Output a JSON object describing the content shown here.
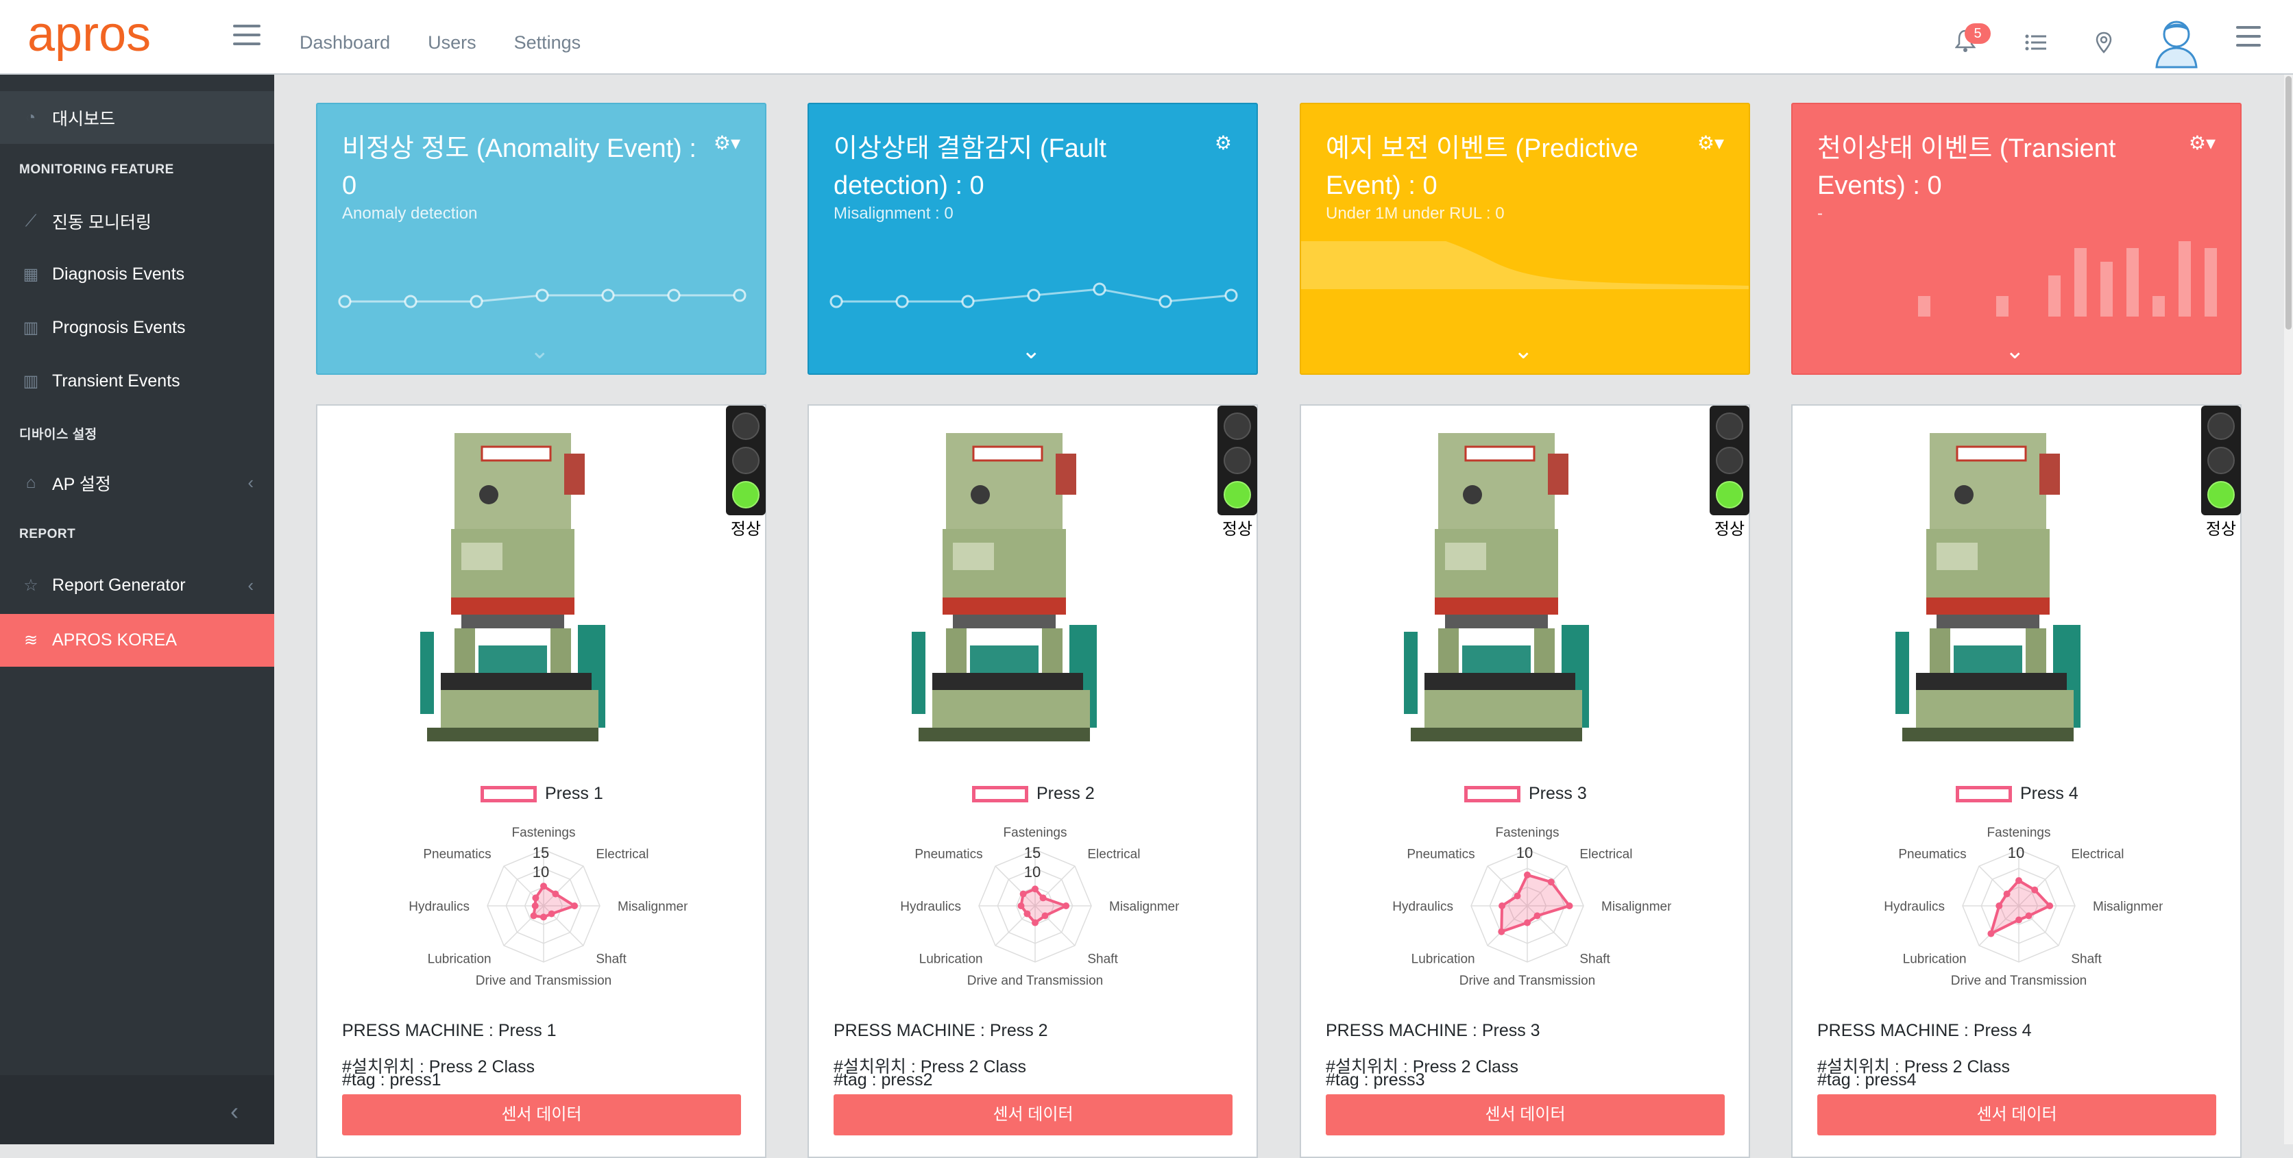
{
  "app": {
    "logo_text": "apros"
  },
  "topnav": [
    "Dashboard",
    "Users",
    "Settings"
  ],
  "notifications": {
    "count": "5"
  },
  "sidebar": {
    "items": [
      {
        "label": "대시보드",
        "icon": "speedometer-icon"
      },
      {
        "title": "MONITORING FEATURE"
      },
      {
        "label": "진동 모니터링",
        "icon": "chart-line-icon"
      },
      {
        "label": "Diagnosis Events",
        "icon": "calendar-icon"
      },
      {
        "label": "Prognosis Events",
        "icon": "bar-chart-icon"
      },
      {
        "label": "Transient Events",
        "icon": "bar-chart-icon"
      },
      {
        "title": "디바이스 설정"
      },
      {
        "label": "AP 설정",
        "icon": "tag-icon"
      },
      {
        "title": "REPORT"
      },
      {
        "label": "Report Generator",
        "icon": "star-icon"
      },
      {
        "label": "APROS KOREA",
        "icon": "layers-icon"
      }
    ]
  },
  "cards": [
    {
      "title": "비정상 정도 (Anomality Event) : 0",
      "sub": "Anomaly detection",
      "color": "#63c2de",
      "line": [
        0,
        0,
        0,
        1,
        1,
        1,
        1
      ]
    },
    {
      "title": "이상상태 결함감지 (Fault detection) : 0",
      "sub": "Misalignment : 0",
      "color": "#20a8d8",
      "line": [
        0,
        0,
        0,
        1,
        2,
        0,
        1
      ]
    },
    {
      "title": "예지 보전 이벤트 (Predictive Event) : 0",
      "sub": "Under 1M under RUL : 0",
      "color": "#ffc107"
    },
    {
      "title": "천이상태 이벤트 (Transient Events) : 0",
      "sub": "-",
      "color": "#f86c6b",
      "bars": [
        0,
        0,
        1.5,
        0,
        0,
        1.5,
        0,
        3,
        5,
        4,
        5,
        1.5,
        7,
        5
      ]
    }
  ],
  "radar_labels": [
    "Fastenings",
    "Electrical",
    "Misalignment",
    "Shaft",
    "Drive and Transmission",
    "Lubrication",
    "Hydraulics",
    "Pneumatics"
  ],
  "machines": [
    {
      "name": "Press 1",
      "status": "정상",
      "machine": "PRESS MACHINE : Press 1",
      "location": "#설치위치 : Press 2 Class",
      "tag": "#tag : press1",
      "button": "센서 데이터",
      "scale": [
        "15",
        "10"
      ],
      "values": [
        0.35,
        0.3,
        0.55,
        0.2,
        0.2,
        0.25,
        0.15,
        0.2
      ]
    },
    {
      "name": "Press 2",
      "status": "정상",
      "machine": "PRESS MACHINE : Press 2",
      "location": "#설치위치 : Press 2 Class",
      "tag": "#tag : press2",
      "button": "센서 데이터",
      "scale": [
        "15",
        "10"
      ],
      "values": [
        0.3,
        0.2,
        0.55,
        0.25,
        0.3,
        0.2,
        0.25,
        0.3
      ]
    },
    {
      "name": "Press 3",
      "status": "정상",
      "machine": "PRESS MACHINE : Press 3",
      "location": "#설치위치 : Press 2 Class",
      "tag": "#tag : press3",
      "button": "센서 데이터",
      "scale": [
        "10"
      ],
      "values": [
        0.55,
        0.6,
        0.75,
        0.25,
        0.3,
        0.65,
        0.45,
        0.25
      ]
    },
    {
      "name": "Press 4",
      "status": "정상",
      "machine": "PRESS MACHINE : Press 4",
      "location": "#설치위치 : Press 2 Class",
      "tag": "#tag : press4",
      "button": "센서 데이터",
      "scale": [
        "10"
      ],
      "values": [
        0.45,
        0.4,
        0.55,
        0.25,
        0.25,
        0.7,
        0.35,
        0.3
      ]
    }
  ]
}
